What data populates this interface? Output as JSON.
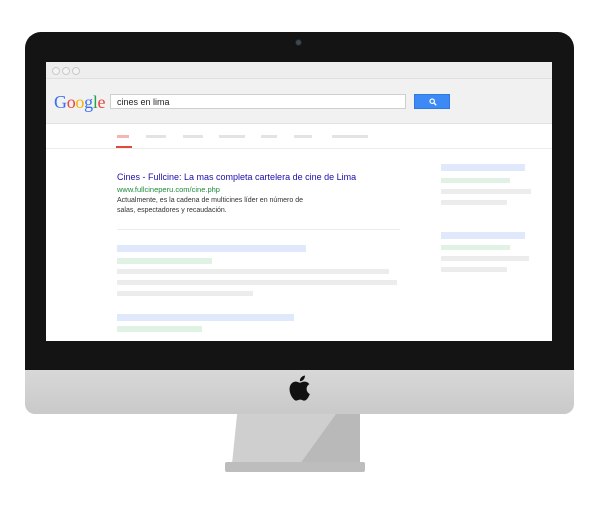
{
  "browser": {
    "window_controls": [
      "close",
      "minimize",
      "maximize"
    ]
  },
  "search": {
    "logo_text": "Google",
    "query": "cines en lima",
    "button_icon": "search-icon"
  },
  "result": {
    "title": "Cines - Fullcine: La mas completa cartelera de cine de Lima",
    "url": "www.fullcineperu.com/cine.php",
    "snippet_line1": "Actualmente, es la cadena de multicines líder en número de",
    "snippet_line2": "salas, espectadores y recaudación."
  },
  "colors": {
    "link": "#1a0dab",
    "url_green": "#1e8a3c",
    "search_button": "#3d8af7",
    "active_tab": "#dd4b39"
  },
  "device": {
    "brand_icon": "apple-logo-icon"
  }
}
